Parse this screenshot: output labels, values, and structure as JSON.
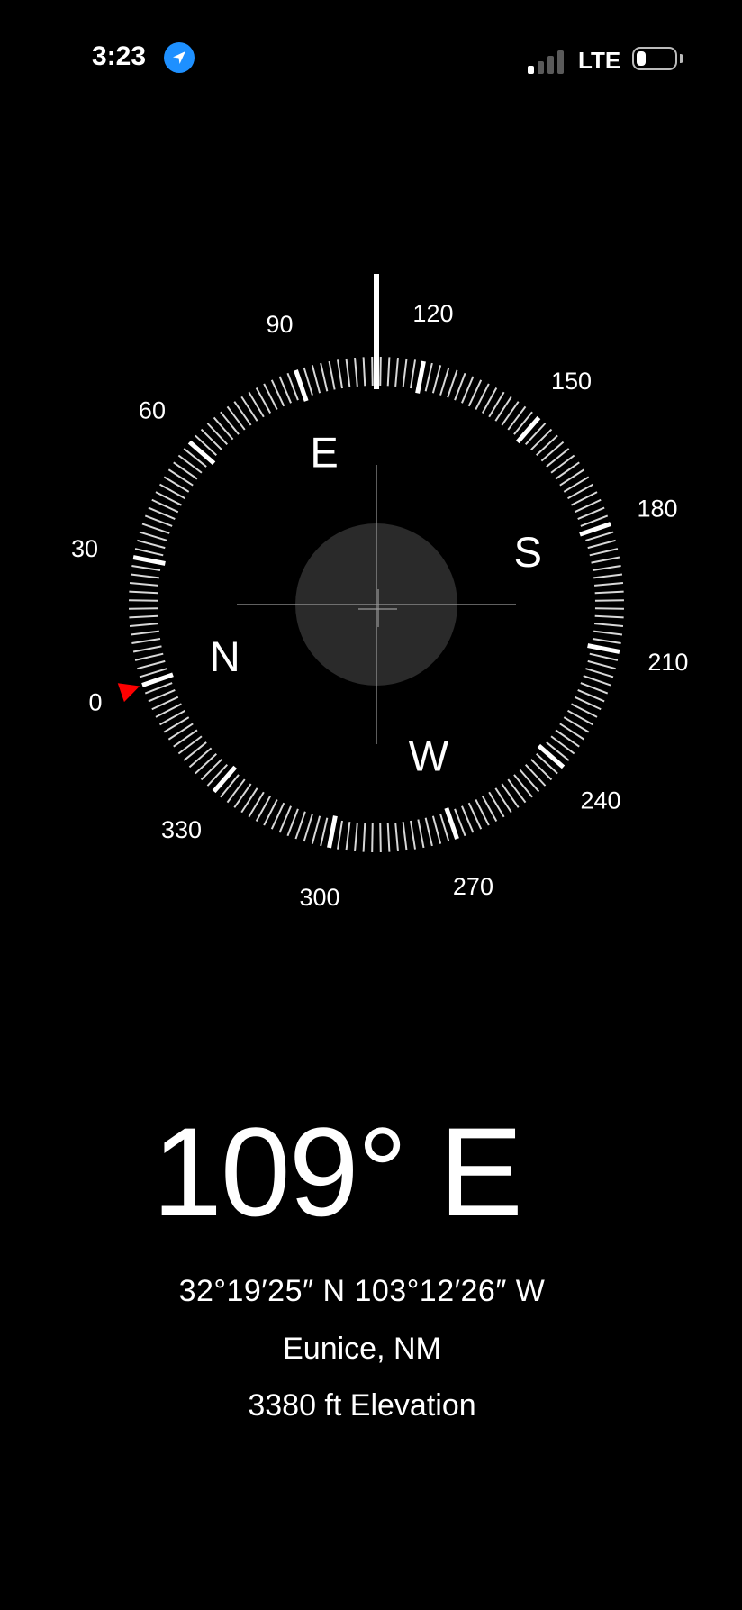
{
  "status_bar": {
    "time": "3:23",
    "location_icon": "location-arrow-icon",
    "network": "LTE",
    "signal_bars": 1,
    "signal_bars_total": 4,
    "battery_icon": "battery-low-icon",
    "battery_fraction": 0.15
  },
  "compass": {
    "degree_labels": [
      "0",
      "30",
      "60",
      "90",
      "120",
      "150",
      "180",
      "210",
      "240",
      "270",
      "300",
      "330"
    ],
    "cardinals": [
      "N",
      "E",
      "S",
      "W"
    ],
    "heading_degrees": 109,
    "reference_marker_degrees": 0,
    "marker_color": "#ff0000",
    "backdrop_color": "#2a2a2a"
  },
  "readout": {
    "heading": "109° E",
    "coordinates": "32°19′25″ N  103°12′26″ W",
    "location": "Eunice, NM",
    "elevation": "3380 ft Elevation"
  }
}
